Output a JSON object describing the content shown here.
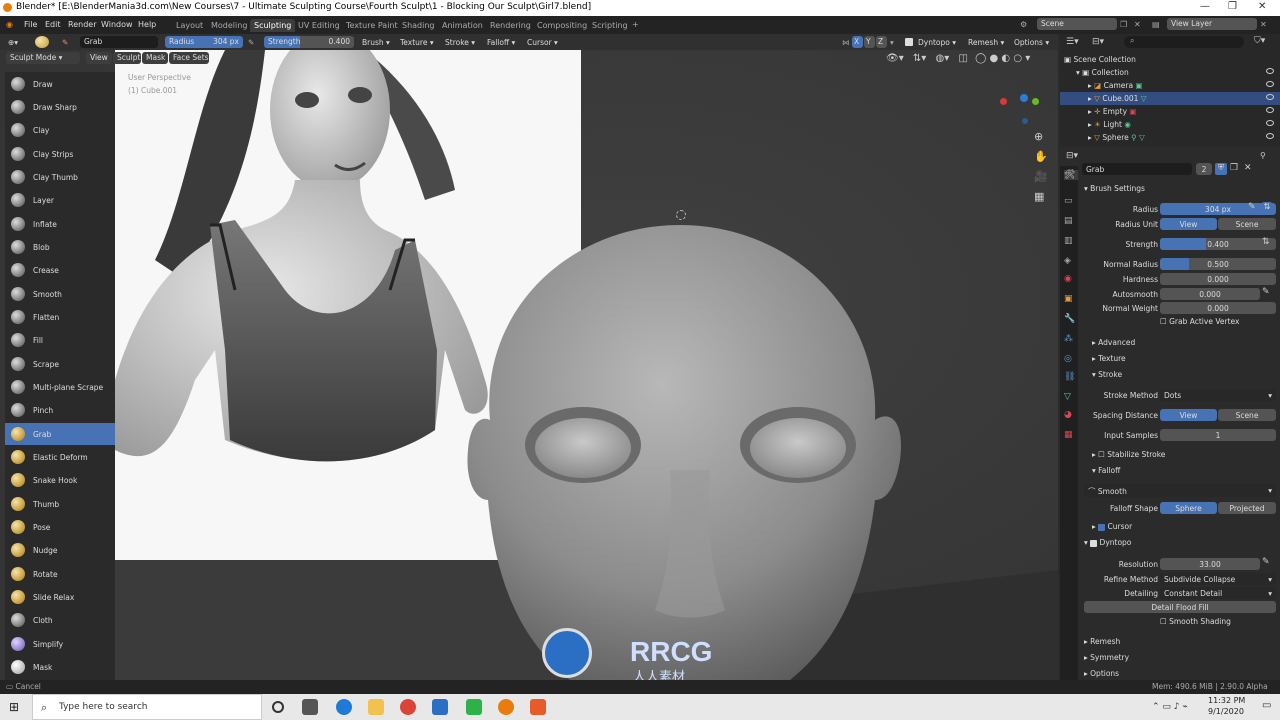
{
  "window": {
    "title": "Blender* [E:\\BlenderMania3d.com\\New Courses\\7 - Ultimate Sculpting Course\\Fourth Sculpt\\1 - Blocking Our Sculpt\\Girl7.blend]"
  },
  "menu": [
    "File",
    "Edit",
    "Render",
    "Window",
    "Help"
  ],
  "workspaces": [
    "Layout",
    "Modeling",
    "Sculpting",
    "UV Editing",
    "Texture Paint",
    "Shading",
    "Animation",
    "Rendering",
    "Compositing",
    "Scripting"
  ],
  "active_workspace": "Sculpting",
  "scene": {
    "label": "Scene",
    "view_layer": "View Layer"
  },
  "tool_header": {
    "brush_name": "Grab",
    "radius_label": "Radius",
    "radius_value": "304 px",
    "strength_label": "Strength",
    "strength_value": "0.400",
    "menus": [
      "Brush",
      "Texture",
      "Stroke",
      "Falloff",
      "Cursor"
    ],
    "right_menus": [
      "Dyntopo",
      "Remesh",
      "Options"
    ],
    "axes": [
      "X",
      "Y",
      "Z"
    ]
  },
  "mode_bar": {
    "mode": "Sculpt Mode",
    "items": [
      "View",
      "Sculpt",
      "Mask",
      "Face Sets"
    ]
  },
  "viewport_overlay": {
    "line1": "User Perspective",
    "line2": "(1) Cube.001"
  },
  "tools": [
    "Draw",
    "Draw Sharp",
    "Clay",
    "Clay Strips",
    "Clay Thumb",
    "Layer",
    "Inflate",
    "Blob",
    "Crease",
    "Smooth",
    "Flatten",
    "Fill",
    "Scrape",
    "Multi-plane Scrape",
    "Pinch",
    "Grab",
    "Elastic Deform",
    "Snake Hook",
    "Thumb",
    "Pose",
    "Nudge",
    "Rotate",
    "Slide Relax",
    "Cloth",
    "Simplify",
    "Mask"
  ],
  "selected_tool": "Grab",
  "outliner": {
    "root": "Scene Collection",
    "collection": "Collection",
    "items": [
      "Camera",
      "Cube.001",
      "Empty",
      "Light",
      "Sphere"
    ],
    "selected": "Cube.001"
  },
  "properties": {
    "brush_name": "Grab",
    "brush_users": "2",
    "brush_settings": "Brush Settings",
    "rows": [
      {
        "label": "Radius",
        "value": "304 px",
        "fill": 0.0,
        "highlight": true
      },
      {
        "label": "Radius Unit",
        "toggle": [
          "View",
          "Scene"
        ]
      },
      {
        "label": "Strength",
        "value": "0.400",
        "fill": 0.4
      },
      {
        "label": "Normal Radius",
        "value": "0.500",
        "fill": 0.25
      },
      {
        "label": "Hardness",
        "value": "0.000",
        "fill": 0
      },
      {
        "label": "Autosmooth",
        "value": "0.000",
        "fill": 0
      },
      {
        "label": "Normal Weight",
        "value": "0.000",
        "fill": 0
      }
    ],
    "grab_active_vertex": "Grab Active Vertex",
    "advanced": "Advanced",
    "texture": "Texture",
    "stroke": "Stroke",
    "stroke_method_label": "Stroke Method",
    "stroke_method": "Dots",
    "spacing_label": "Spacing Distance",
    "spacing_toggle": [
      "View",
      "Scene"
    ],
    "input_samples_label": "Input Samples",
    "input_samples": "1",
    "stabilize": "Stabilize Stroke",
    "falloff": "Falloff",
    "falloff_preset": "Smooth",
    "falloff_shape_label": "Falloff Shape",
    "falloff_shape": [
      "Sphere",
      "Projected"
    ],
    "cursor": "Cursor",
    "dyntopo": "Dyntopo",
    "resolution_label": "Resolution",
    "resolution": "33.00",
    "refine_label": "Refine Method",
    "refine": "Subdivide Collapse",
    "detailing_label": "Detailing",
    "detailing": "Constant Detail",
    "detail_flood": "Detail Flood Fill",
    "smooth_shading": "Smooth Shading",
    "remesh": "Remesh",
    "symmetry": "Symmetry",
    "options": "Options"
  },
  "status": {
    "left": "Cancel",
    "right": "Mem: 490.6 MiB | 2.90.0 Alpha"
  },
  "taskbar": {
    "search_placeholder": "Type here to search",
    "time": "11:32 PM",
    "date": "9/1/2020"
  },
  "watermark": {
    "text": "RRCG",
    "sub": "人人素材"
  }
}
